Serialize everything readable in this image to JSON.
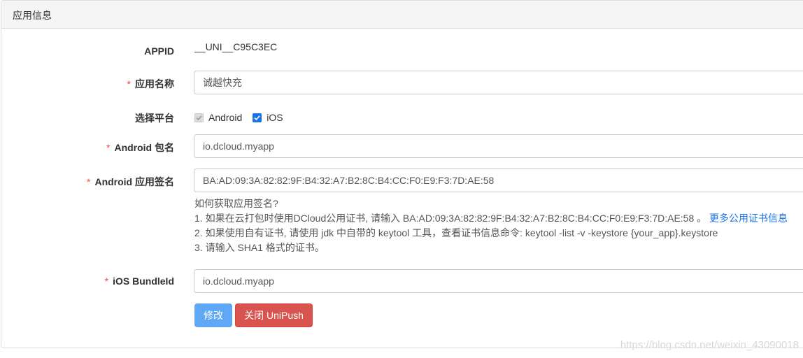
{
  "panel": {
    "title": "应用信息"
  },
  "form": {
    "appid": {
      "label": "APPID",
      "value": "__UNI__C95C3EC"
    },
    "app_name": {
      "required": "*",
      "label": "应用名称",
      "value": "诚越快充"
    },
    "platform": {
      "label": "选择平台",
      "android_label": "Android",
      "ios_label": "iOS",
      "android_checked": true,
      "android_disabled": true,
      "ios_checked": true
    },
    "android_package": {
      "required": "*",
      "label": "Android 包名",
      "value": "io.dcloud.myapp"
    },
    "android_signature": {
      "required": "*",
      "label": "Android 应用签名",
      "value": "BA:AD:09:3A:82:82:9F:B4:32:A7:B2:8C:B4:CC:F0:E9:F3:7D:AE:58"
    },
    "help": {
      "question": "如何获取应用签名?",
      "line1": "1. 如果在云打包时使用DCloud公用证书, 请输入 BA:AD:09:3A:82:82:9F:B4:32:A7:B2:8C:B4:CC:F0:E9:F3:7D:AE:58 。",
      "line1_link": "更多公用证书信息",
      "line2": "2. 如果使用自有证书, 请使用 jdk 中自带的 keytool 工具，查看证书信息命令: keytool -list -v -keystore {your_app}.keystore",
      "line3": "3. 请输入 SHA1 格式的证书。"
    },
    "ios_bundleid": {
      "required": "*",
      "label": "iOS BundleId",
      "value": "io.dcloud.myapp"
    }
  },
  "buttons": {
    "modify": "修改",
    "close_unipush": "关闭 UniPush"
  },
  "watermark": "https://blog.csdn.net/weixin_43090018",
  "colors": {
    "required": "#e74c3c",
    "primary": "#5fa8f5",
    "danger": "#d9534f",
    "link": "#1a73e8",
    "checkbox": "#1a73e8"
  }
}
